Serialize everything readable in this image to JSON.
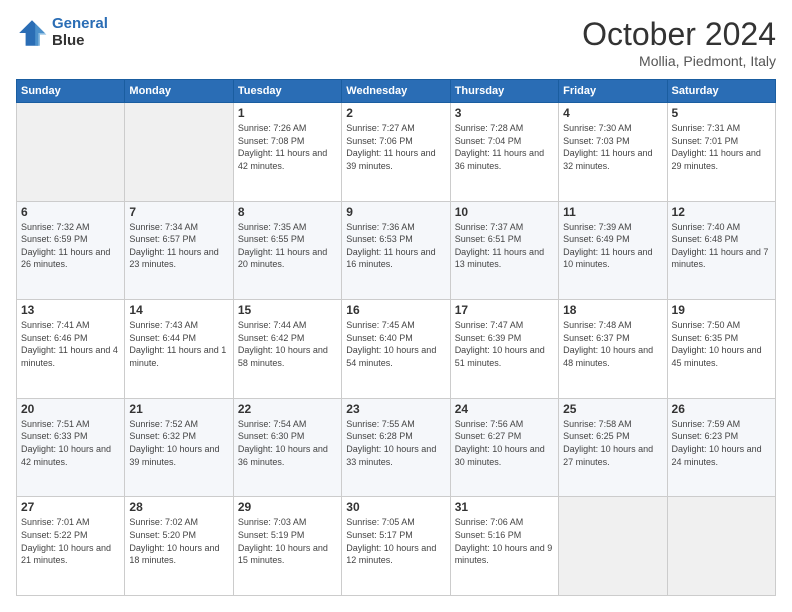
{
  "header": {
    "logo_line1": "General",
    "logo_line2": "Blue",
    "month": "October 2024",
    "location": "Mollia, Piedmont, Italy"
  },
  "weekdays": [
    "Sunday",
    "Monday",
    "Tuesday",
    "Wednesday",
    "Thursday",
    "Friday",
    "Saturday"
  ],
  "weeks": [
    [
      {
        "day": "",
        "info": ""
      },
      {
        "day": "",
        "info": ""
      },
      {
        "day": "1",
        "info": "Sunrise: 7:26 AM\nSunset: 7:08 PM\nDaylight: 11 hours and 42 minutes."
      },
      {
        "day": "2",
        "info": "Sunrise: 7:27 AM\nSunset: 7:06 PM\nDaylight: 11 hours and 39 minutes."
      },
      {
        "day": "3",
        "info": "Sunrise: 7:28 AM\nSunset: 7:04 PM\nDaylight: 11 hours and 36 minutes."
      },
      {
        "day": "4",
        "info": "Sunrise: 7:30 AM\nSunset: 7:03 PM\nDaylight: 11 hours and 32 minutes."
      },
      {
        "day": "5",
        "info": "Sunrise: 7:31 AM\nSunset: 7:01 PM\nDaylight: 11 hours and 29 minutes."
      }
    ],
    [
      {
        "day": "6",
        "info": "Sunrise: 7:32 AM\nSunset: 6:59 PM\nDaylight: 11 hours and 26 minutes."
      },
      {
        "day": "7",
        "info": "Sunrise: 7:34 AM\nSunset: 6:57 PM\nDaylight: 11 hours and 23 minutes."
      },
      {
        "day": "8",
        "info": "Sunrise: 7:35 AM\nSunset: 6:55 PM\nDaylight: 11 hours and 20 minutes."
      },
      {
        "day": "9",
        "info": "Sunrise: 7:36 AM\nSunset: 6:53 PM\nDaylight: 11 hours and 16 minutes."
      },
      {
        "day": "10",
        "info": "Sunrise: 7:37 AM\nSunset: 6:51 PM\nDaylight: 11 hours and 13 minutes."
      },
      {
        "day": "11",
        "info": "Sunrise: 7:39 AM\nSunset: 6:49 PM\nDaylight: 11 hours and 10 minutes."
      },
      {
        "day": "12",
        "info": "Sunrise: 7:40 AM\nSunset: 6:48 PM\nDaylight: 11 hours and 7 minutes."
      }
    ],
    [
      {
        "day": "13",
        "info": "Sunrise: 7:41 AM\nSunset: 6:46 PM\nDaylight: 11 hours and 4 minutes."
      },
      {
        "day": "14",
        "info": "Sunrise: 7:43 AM\nSunset: 6:44 PM\nDaylight: 11 hours and 1 minute."
      },
      {
        "day": "15",
        "info": "Sunrise: 7:44 AM\nSunset: 6:42 PM\nDaylight: 10 hours and 58 minutes."
      },
      {
        "day": "16",
        "info": "Sunrise: 7:45 AM\nSunset: 6:40 PM\nDaylight: 10 hours and 54 minutes."
      },
      {
        "day": "17",
        "info": "Sunrise: 7:47 AM\nSunset: 6:39 PM\nDaylight: 10 hours and 51 minutes."
      },
      {
        "day": "18",
        "info": "Sunrise: 7:48 AM\nSunset: 6:37 PM\nDaylight: 10 hours and 48 minutes."
      },
      {
        "day": "19",
        "info": "Sunrise: 7:50 AM\nSunset: 6:35 PM\nDaylight: 10 hours and 45 minutes."
      }
    ],
    [
      {
        "day": "20",
        "info": "Sunrise: 7:51 AM\nSunset: 6:33 PM\nDaylight: 10 hours and 42 minutes."
      },
      {
        "day": "21",
        "info": "Sunrise: 7:52 AM\nSunset: 6:32 PM\nDaylight: 10 hours and 39 minutes."
      },
      {
        "day": "22",
        "info": "Sunrise: 7:54 AM\nSunset: 6:30 PM\nDaylight: 10 hours and 36 minutes."
      },
      {
        "day": "23",
        "info": "Sunrise: 7:55 AM\nSunset: 6:28 PM\nDaylight: 10 hours and 33 minutes."
      },
      {
        "day": "24",
        "info": "Sunrise: 7:56 AM\nSunset: 6:27 PM\nDaylight: 10 hours and 30 minutes."
      },
      {
        "day": "25",
        "info": "Sunrise: 7:58 AM\nSunset: 6:25 PM\nDaylight: 10 hours and 27 minutes."
      },
      {
        "day": "26",
        "info": "Sunrise: 7:59 AM\nSunset: 6:23 PM\nDaylight: 10 hours and 24 minutes."
      }
    ],
    [
      {
        "day": "27",
        "info": "Sunrise: 7:01 AM\nSunset: 5:22 PM\nDaylight: 10 hours and 21 minutes."
      },
      {
        "day": "28",
        "info": "Sunrise: 7:02 AM\nSunset: 5:20 PM\nDaylight: 10 hours and 18 minutes."
      },
      {
        "day": "29",
        "info": "Sunrise: 7:03 AM\nSunset: 5:19 PM\nDaylight: 10 hours and 15 minutes."
      },
      {
        "day": "30",
        "info": "Sunrise: 7:05 AM\nSunset: 5:17 PM\nDaylight: 10 hours and 12 minutes."
      },
      {
        "day": "31",
        "info": "Sunrise: 7:06 AM\nSunset: 5:16 PM\nDaylight: 10 hours and 9 minutes."
      },
      {
        "day": "",
        "info": ""
      },
      {
        "day": "",
        "info": ""
      }
    ]
  ]
}
